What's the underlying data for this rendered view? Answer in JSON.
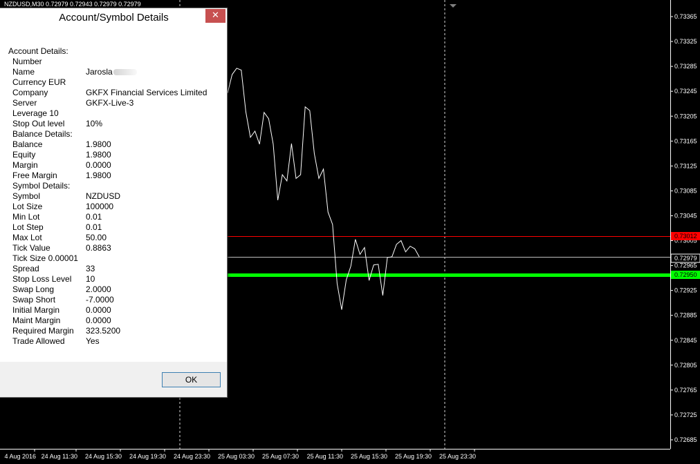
{
  "chart": {
    "title": "NZDUSD,M30  0.72979 0.72943 0.72979 0.72979",
    "colors": {
      "background": "#000000",
      "price_line": "#ffffff",
      "ask_line": "#ff0000",
      "bid_line": "#c0c0c0",
      "stop_line": "#00ff00",
      "axis_text": "#ffffff",
      "period_separator": "#ffffff"
    }
  },
  "chart_data": {
    "type": "line",
    "title": "NZDUSD,M30  0.72979 0.72943 0.72979 0.72979",
    "symbol": "NZDUSD",
    "timeframe": "M30",
    "ylim": [
      0.72675,
      0.73385
    ],
    "y_ticks": [
      "0.73365",
      "0.73325",
      "0.73285",
      "0.73245",
      "0.73205",
      "0.73165",
      "0.73125",
      "0.73085",
      "0.73045",
      "0.73005",
      "0.72965",
      "0.72925",
      "0.72885",
      "0.72845",
      "0.72805",
      "0.72765",
      "0.72725",
      "0.72685"
    ],
    "y_tick_values": [
      0.73365,
      0.73325,
      0.73285,
      0.73245,
      0.73205,
      0.73165,
      0.73125,
      0.73085,
      0.73045,
      0.73005,
      0.72965,
      0.72925,
      0.72885,
      0.72845,
      0.72805,
      0.72765,
      0.72725,
      0.72685
    ],
    "x_ticks": [
      "4 Aug 2016",
      "24 Aug 11:30",
      "24 Aug 15:30",
      "24 Aug 19:30",
      "24 Aug 23:30",
      "25 Aug 03:30",
      "25 Aug 07:30",
      "25 Aug 11:30",
      "25 Aug 15:30",
      "25 Aug 19:30",
      "25 Aug 23:30"
    ],
    "levels": [
      {
        "label": "0.73012",
        "value": 0.73012,
        "color": "#ff0000"
      },
      {
        "label": "0.72979",
        "value": 0.72979,
        "color": "#c0c0c0"
      },
      {
        "label": "0.72950",
        "value": 0.7295,
        "color": "#00ff00"
      }
    ],
    "series": [
      {
        "values": [
          0.73242,
          0.73272,
          0.73282,
          0.73279,
          0.73212,
          0.73171,
          0.73181,
          0.7316,
          0.73211,
          0.73201,
          0.7316,
          0.7307,
          0.73111,
          0.73101,
          0.73161,
          0.73105,
          0.73111,
          0.7322,
          0.73214,
          0.73145,
          0.73105,
          0.7312,
          0.73051,
          0.73031,
          0.72936,
          0.72894,
          0.72942,
          0.72964,
          0.73007,
          0.72983,
          0.72994,
          0.72941,
          0.72966,
          0.72967,
          0.72917,
          0.72978,
          0.72979,
          0.72999,
          0.73005,
          0.72987,
          0.72996,
          0.72992,
          0.72979
        ]
      }
    ],
    "grid": false
  },
  "dialog": {
    "title": "Account/Symbol Details",
    "close_glyph": "✕",
    "ok_label": "OK",
    "rows": [
      {
        "label": "Account Details:",
        "value": "",
        "section": true
      },
      {
        "label": "Number",
        "value": ""
      },
      {
        "label": "Name",
        "value": "Jarosla",
        "blurred": true
      },
      {
        "label": "Currency EUR",
        "value": ""
      },
      {
        "label": "Company",
        "value": "GKFX Financial Services Limited"
      },
      {
        "label": "Server",
        "value": "GKFX-Live-3"
      },
      {
        "label": "Leverage 10",
        "value": ""
      },
      {
        "label": "Stop Out level",
        "value": "10%"
      },
      {
        "label": "Balance Details:",
        "value": "",
        "subsection": true
      },
      {
        "label": "Balance",
        "value": "1.9800"
      },
      {
        "label": "Equity",
        "value": "1.9800"
      },
      {
        "label": "Margin",
        "value": "0.0000"
      },
      {
        "label": "Free Margin",
        "value": "1.9800"
      },
      {
        "label": "Symbol Details:",
        "value": "",
        "subsection": true
      },
      {
        "label": "Symbol",
        "value": "NZDUSD"
      },
      {
        "label": "Lot Size",
        "value": "100000"
      },
      {
        "label": "Min Lot",
        "value": "0.01"
      },
      {
        "label": "Lot Step",
        "value": "0.01"
      },
      {
        "label": "Max Lot",
        "value": "50.00"
      },
      {
        "label": "Tick Value",
        "value": "0.8863"
      },
      {
        "label": "Tick Size 0.00001",
        "value": ""
      },
      {
        "label": "Spread",
        "value": "33"
      },
      {
        "label": "Stop Loss Level",
        "value": "10"
      },
      {
        "label": "Swap Long",
        "value": "2.0000"
      },
      {
        "label": "Swap Short",
        "value": "-7.0000"
      },
      {
        "label": "Initial Margin",
        "value": "0.0000"
      },
      {
        "label": "Maint Margin",
        "value": "0.0000"
      },
      {
        "label": "Required Margin",
        "value": "323.5200"
      },
      {
        "label": "Trade Allowed",
        "value": "Yes"
      }
    ]
  }
}
